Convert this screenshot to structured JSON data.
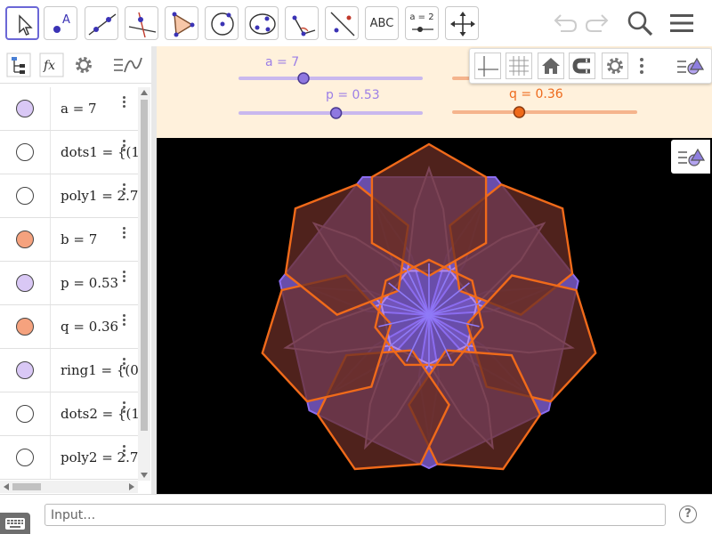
{
  "toolbar": {
    "tools": [
      {
        "name": "move-tool",
        "icon": "arrow-pointer-icon",
        "active": true
      },
      {
        "name": "point-tool",
        "icon": "point-icon",
        "label": "A"
      },
      {
        "name": "line-tool",
        "icon": "line-icon"
      },
      {
        "name": "perpendicular-line-tool",
        "icon": "perpendicular-icon"
      },
      {
        "name": "polygon-tool",
        "icon": "polygon-icon"
      },
      {
        "name": "circle-tool",
        "icon": "circle-center-icon"
      },
      {
        "name": "conic-tool",
        "icon": "ellipse-icon"
      },
      {
        "name": "angle-tool",
        "icon": "angle-icon"
      },
      {
        "name": "reflect-tool",
        "icon": "reflect-icon"
      },
      {
        "name": "text-tool",
        "icon": "text-icon",
        "label": "ABC"
      },
      {
        "name": "slider-tool",
        "icon": "slider-icon",
        "label": "a = 2"
      },
      {
        "name": "move-graphics-tool",
        "icon": "move-arrows-icon"
      }
    ],
    "right": [
      "undo-icon",
      "redo-icon",
      "search-icon",
      "menu-icon"
    ]
  },
  "algebra": {
    "header_buttons": [
      "tree-view-icon",
      "fx-icon",
      "gear-icon",
      "graph-icon"
    ],
    "fx_label": "fx",
    "rows": [
      {
        "text": "a = 7",
        "color": "#d9c8f5"
      },
      {
        "text": "dots1 = {(1",
        "color": "#ffffff"
      },
      {
        "text": "poly1 = 2.7",
        "color": "#ffffff"
      },
      {
        "text": "b = 7",
        "color": "#f5a27e"
      },
      {
        "text": "p = 0.53",
        "color": "#d9c8f5"
      },
      {
        "text": "q = 0.36",
        "color": "#f5a27e"
      },
      {
        "text": "ring1 = {(0.",
        "color": "#d9c8f5"
      },
      {
        "text": "dots2 = {(1",
        "color": "#ffffff"
      },
      {
        "text": "poly2 = 2.7",
        "color": "#ffffff"
      }
    ]
  },
  "sliders": {
    "a": {
      "label": "a = 7",
      "value": 7,
      "min": 0,
      "max": 20,
      "color": "#9c7fe6"
    },
    "b": {
      "value": 7,
      "min": 0,
      "max": 20,
      "color": "#f28b4f"
    },
    "p": {
      "label": "p = 0.53",
      "value": 0.53,
      "min": 0,
      "max": 1,
      "color": "#9c7fe6"
    },
    "q": {
      "label": "q = 0.36",
      "value": 0.36,
      "min": 0,
      "max": 1,
      "color": "#ee6a1c"
    }
  },
  "graphics": {
    "style_bar": [
      "axes-icon",
      "grid-icon",
      "home-icon",
      "magnet-icon",
      "gear-icon",
      "more-icon",
      "style-bar-toggle-icon"
    ],
    "colors": {
      "purple_stroke": "#8b6cf0",
      "purple_fill": "#7b5bc8",
      "orange_stroke": "#f06a1a",
      "orange_fill": "#6a2d26",
      "background": "#000000"
    }
  },
  "input": {
    "placeholder": "Input…",
    "help": "?"
  }
}
